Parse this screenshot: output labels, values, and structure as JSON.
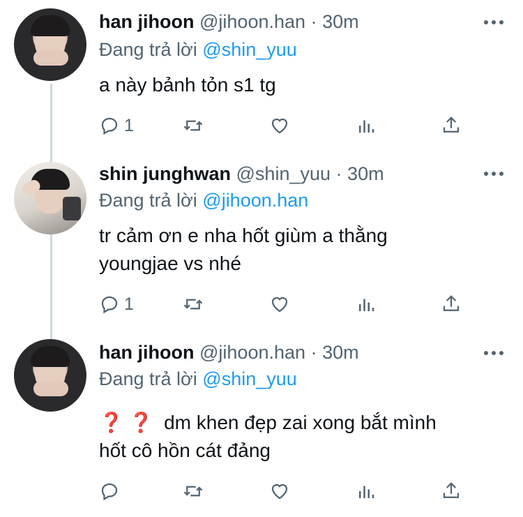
{
  "tweets": [
    {
      "name": "han jihoon",
      "handle": "@jihoon.han",
      "dot": "·",
      "time": "30m",
      "replying_prefix": "Đang trả lời",
      "replying_to": "@shin_yuu",
      "text_lines": [
        "a này bảnh tỏn s1 tg"
      ],
      "reply_count": "1",
      "avatar_icon": "profile-photo-han-jihoon"
    },
    {
      "name": "shin junghwan",
      "handle": "@shin_yuu",
      "dot": "·",
      "time": "30m",
      "replying_prefix": "Đang trả lời",
      "replying_to": "@jihoon.han",
      "text_lines": [
        "tr cảm ơn e nha hốt giùm a thằng",
        "youngjae vs nhé"
      ],
      "reply_count": "1",
      "avatar_icon": "profile-photo-shin-junghwan"
    },
    {
      "name": "han jihoon",
      "handle": "@jihoon.han",
      "dot": "·",
      "time": "30m",
      "replying_prefix": "Đang trả lời",
      "replying_to": "@shin_yuu",
      "emoji": "❓ ❓",
      "text_lines": [
        "dm khen đẹp zai xong bắt mình",
        "hốt cô hồn cát đảng"
      ],
      "reply_count": "",
      "avatar_icon": "profile-photo-han-jihoon"
    }
  ],
  "icons": {
    "reply": "reply-icon",
    "retweet": "retweet-icon",
    "like": "heart-icon",
    "stats": "stats-icon",
    "share": "share-icon",
    "more": "more-icon"
  },
  "colors": {
    "text": "#0f1419",
    "secondary": "#536471",
    "link": "#1d9bf0",
    "thread_line": "#cfd9de"
  }
}
